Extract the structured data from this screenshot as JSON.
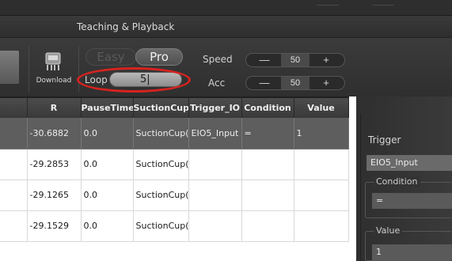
{
  "window": {
    "section_title": "Teaching & Playback"
  },
  "toolbar": {
    "download_label": "Download",
    "mode_easy": "Easy",
    "mode_pro": "Pro",
    "loop_label": "Loop",
    "loop_value": "5|",
    "speed_label": "Speed",
    "speed_value": "50",
    "acc_label": "Acc",
    "acc_value": "50",
    "minus": "—",
    "plus": "+"
  },
  "table": {
    "columns": [
      "R",
      "PauseTime",
      "SuctionCup",
      "Trigger_IO",
      "Condition",
      "Value"
    ],
    "rows": [
      [
        "-30.6882",
        "0.0",
        "SuctionCup(",
        "EIO5_Input",
        "=",
        "1"
      ],
      [
        "-29.2853",
        "0.0",
        "SuctionCup(",
        "",
        "",
        ""
      ],
      [
        "-29.1265",
        "0.0",
        "SuctionCup(",
        "",
        "",
        ""
      ],
      [
        "-29.1529",
        "0.0",
        "SuctionCup(",
        "",
        "",
        ""
      ]
    ],
    "selected_row": 0
  },
  "panel": {
    "trigger_label": "Trigger",
    "trigger_value": "EIO5_Input",
    "condition_label": "Condition",
    "condition_value": "=",
    "value_label": "Value",
    "value_value": "1"
  },
  "colors": {
    "highlight": "#d6231f",
    "toolbar_bg": "#333333",
    "selected_row": "#5e5e5e"
  }
}
